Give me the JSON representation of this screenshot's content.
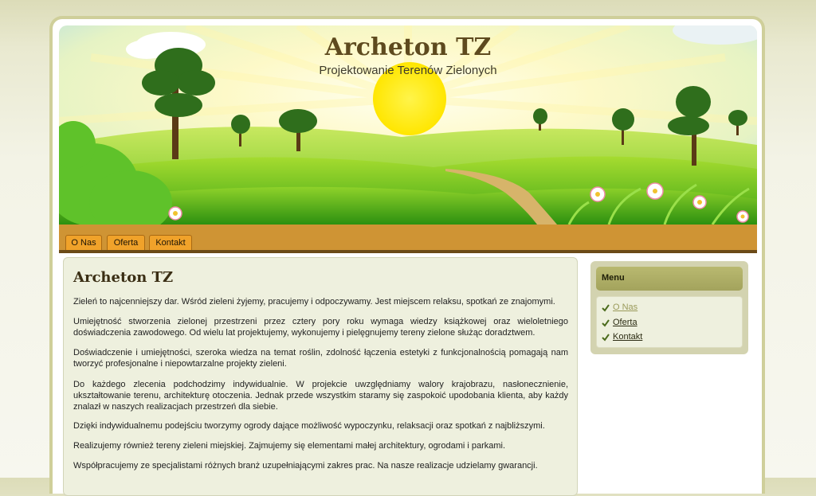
{
  "header": {
    "title": "Archeton TZ",
    "subtitle": "Projektowanie Terenów Zielonych"
  },
  "nav": {
    "tabs": [
      {
        "label": "O Nas"
      },
      {
        "label": "Oferta"
      },
      {
        "label": "Kontakt"
      }
    ]
  },
  "content": {
    "heading": "Archeton TZ",
    "paragraphs": [
      "Zieleń to najcenniejszy dar. Wśród zieleni żyjemy, pracujemy i odpoczywamy. Jest miejscem relaksu, spotkań ze znajomymi.",
      "Umiejętność stworzenia zielonej przestrzeni przez cztery pory roku wymaga wiedzy książkowej oraz wieloletniego doświadczenia zawodowego. Od wielu lat projektujemy, wykonujemy i pielęgnujemy tereny zielone służąc doradztwem.",
      "Doświadczenie i umiejętności, szeroka wiedza na temat roślin, zdolność łączenia estetyki z funkcjonalnością pomagają nam tworzyć profesjonalne i niepowtarzalne projekty zieleni.",
      "Do każdego zlecenia podchodzimy indywidualnie. W projekcie uwzględniamy walory krajobrazu, nasłonecznienie, ukształtowanie terenu, architekturę otoczenia. Jednak przede wszystkim staramy się zaspokoić upodobania klienta, aby każdy znalazł w naszych realizacjach przestrzeń dla siebie.",
      "Dzięki indywidualnemu podejściu tworzymy ogrody dające możliwość wypoczynku, relaksacji oraz spotkań z najbliższymi.",
      "Realizujemy również tereny zieleni miejskiej. Zajmujemy się elementami małej architektury, ogrodami i parkami.",
      "Współpracujemy ze specjalistami różnych branż uzupełniającymi zakres prac. Na nasze realizacje udzielamy gwarancji."
    ]
  },
  "sidebar": {
    "menu_title": "Menu",
    "items": [
      {
        "label": "O Nas",
        "active": true
      },
      {
        "label": "Oferta",
        "active": false
      },
      {
        "label": "Kontakt",
        "active": false
      }
    ]
  },
  "colors": {
    "nav_bar": "#cf9434",
    "nav_tab": "#f0a22a",
    "content_bg": "#eef0de",
    "sidebar_bg": "#d3d3b0",
    "menu_header": "#a9a962",
    "link_active": "#9a9a5a",
    "link": "#2b2b12"
  }
}
